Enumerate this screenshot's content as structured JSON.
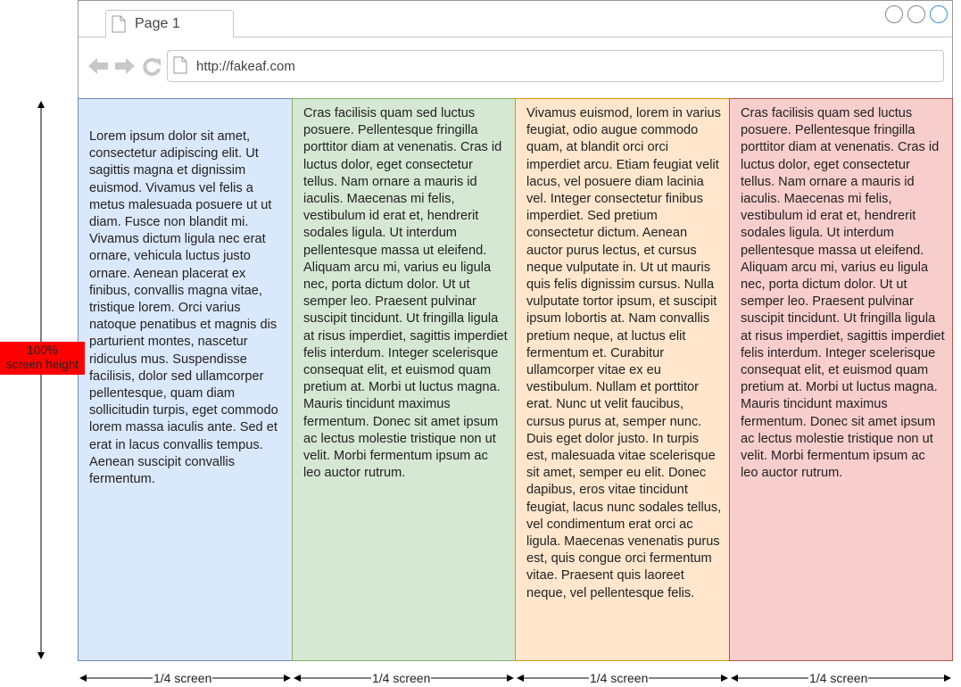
{
  "browser": {
    "tab_title": "Page 1",
    "url": "http://fakeaf.com",
    "icons": [
      "document-icon",
      "back-arrow-icon",
      "forward-arrow-icon",
      "reload-icon",
      "window-control-icon"
    ]
  },
  "columns": [
    {
      "text": "Lorem ipsum dolor sit amet, consectetur adipiscing elit. Ut sagittis magna et dignissim euismod. Vivamus vel felis a metus malesuada posuere ut ut diam. Fusce non blandit mi. Vivamus dictum ligula nec erat ornare, vehicula luctus justo ornare. Aenean placerat ex finibus, convallis magna vitae, tristique lorem. Orci varius natoque penatibus et magnis dis parturient montes, nascetur ridiculus mus. Suspendisse facilisis, dolor sed ullamcorper pellentesque, quam diam sollicitudin turpis, eget commodo lorem massa iaculis ante. Sed et erat in lacus convallis tempus. Aenean suscipit convallis fermentum.",
      "color": "#dae8fc",
      "border": "#6c8ebf"
    },
    {
      "text": "Cras facilisis quam sed luctus posuere. Pellentesque fringilla porttitor diam at venenatis. Cras id luctus dolor, eget consectetur tellus. Nam ornare a mauris id iaculis. Maecenas mi felis, vestibulum id erat et, hendrerit sodales ligula. Ut interdum pellentesque massa ut eleifend. Aliquam arcu mi, varius eu ligula nec, porta dictum dolor. Ut ut semper leo. Praesent pulvinar suscipit tincidunt. Ut fringilla ligula at risus imperdiet, sagittis imperdiet felis interdum. Integer scelerisque consequat elit, et euismod quam pretium at. Morbi ut luctus magna. Mauris tincidunt maximus fermentum. Donec sit amet ipsum ac lectus molestie tristique non ut velit. Morbi fermentum ipsum ac leo auctor rutrum.",
      "color": "#d5e8d4",
      "border": "#82b366"
    },
    {
      "text": "Vivamus euismod, lorem in varius feugiat, odio augue commodo quam, at blandit orci orci imperdiet arcu. Etiam feugiat velit lacus, vel posuere diam lacinia vel. Integer consectetur finibus imperdiet. Sed pretium consectetur dictum. Aenean auctor purus lectus, et cursus neque vulputate in. Ut ut mauris quis felis dignissim cursus. Nulla vulputate tortor ipsum, et suscipit ipsum lobortis at. Nam convallis pretium neque, at luctus elit fermentum et. Curabitur ullamcorper vitae ex eu vestibulum. Nullam et porttitor erat. Nunc ut velit faucibus, cursus purus at, semper nunc. Duis eget dolor justo. In turpis est, malesuada vitae scelerisque sit amet, semper eu elit. Donec dapibus, eros vitae tincidunt feugiat, lacus nunc sodales tellus, vel condimentum erat orci ac ligula. Maecenas venenatis purus est, quis congue orci fermentum vitae. Praesent quis laoreet neque, vel pellentesque felis.",
      "color": "#ffe6cc",
      "border": "#d79b00"
    },
    {
      "text": "Cras facilisis quam sed luctus posuere. Pellentesque fringilla porttitor diam at venenatis. Cras id luctus dolor, eget consectetur tellus. Nam ornare a mauris id iaculis. Maecenas mi felis, vestibulum id erat et, hendrerit sodales ligula. Ut interdum pellentesque massa ut eleifend. Aliquam arcu mi, varius eu ligula nec, porta dictum dolor. Ut ut semper leo. Praesent pulvinar suscipit tincidunt. Ut fringilla ligula at risus imperdiet, sagittis imperdiet felis interdum. Integer scelerisque consequat elit, et euismod quam pretium at. Morbi ut luctus magna. Mauris tincidunt maximus fermentum. Donec sit amet ipsum ac lectus molestie tristique non ut velit. Morbi fermentum ipsum ac leo auctor rutrum.",
      "color": "#f8cecc",
      "border": "#b85450"
    }
  ],
  "annotations": {
    "height_label": "100%\nscreen height",
    "height_label_line1": "100%",
    "height_label_line2": "screen height",
    "height_label_color": "#ff0000",
    "width_labels": [
      "1/4 screen",
      "1/4 screen",
      "1/4 screen",
      "1/4 screen"
    ]
  }
}
